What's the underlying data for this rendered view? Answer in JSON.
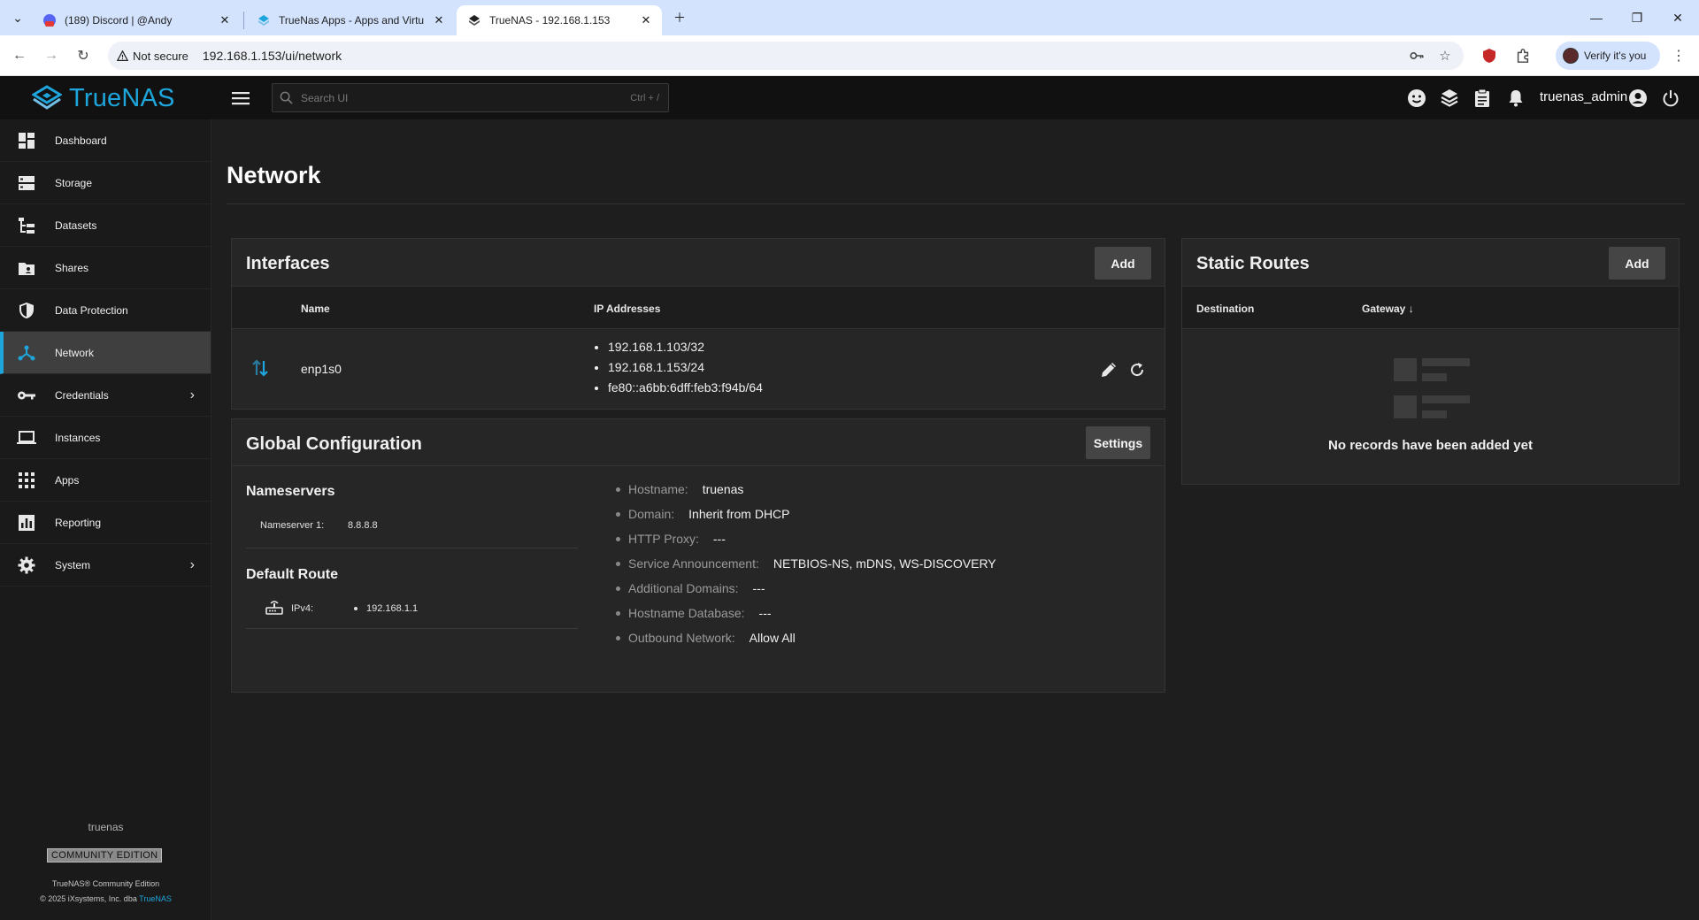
{
  "browser": {
    "tabs": [
      {
        "title": "(189) Discord | @Andy",
        "badge": "189"
      },
      {
        "title": "TrueNas Apps - Apps and Virtu"
      },
      {
        "title": "TrueNAS - 192.168.1.153"
      }
    ],
    "address": {
      "security_label": "Not secure",
      "url": "192.168.1.153/ui/network"
    },
    "verify_label": "Verify it's you"
  },
  "app": {
    "logo_text": "TrueNAS",
    "search_placeholder": "Search UI",
    "search_shortcut": "Ctrl + /",
    "username": "truenas_admin"
  },
  "sidebar": {
    "items": [
      {
        "label": "Dashboard",
        "icon": "dashboard-icon"
      },
      {
        "label": "Storage",
        "icon": "storage-icon"
      },
      {
        "label": "Datasets",
        "icon": "datasets-icon"
      },
      {
        "label": "Shares",
        "icon": "shares-icon"
      },
      {
        "label": "Data Protection",
        "icon": "shield-icon"
      },
      {
        "label": "Network",
        "icon": "network-icon",
        "active": true
      },
      {
        "label": "Credentials",
        "icon": "key-icon",
        "expandable": true
      },
      {
        "label": "Instances",
        "icon": "laptop-icon"
      },
      {
        "label": "Apps",
        "icon": "apps-grid-icon"
      },
      {
        "label": "Reporting",
        "icon": "chart-icon"
      },
      {
        "label": "System",
        "icon": "gear-icon",
        "expandable": true
      }
    ],
    "hostname": "truenas",
    "edition_badge": "COMMUNITY EDITION",
    "footer_line1": "TrueNAS® Community Edition",
    "footer_line2_prefix": "© 2025 iXsystems, Inc. dba ",
    "footer_line2_brand": "TrueNAS"
  },
  "page": {
    "title": "Network"
  },
  "interfaces": {
    "title": "Interfaces",
    "add_label": "Add",
    "columns": {
      "name": "Name",
      "ip": "IP Addresses"
    },
    "rows": [
      {
        "name": "enp1s0",
        "ips": [
          "192.168.1.103/32",
          "192.168.1.153/24",
          "fe80::a6bb:6dff:feb3:f94b/64"
        ]
      }
    ]
  },
  "global_config": {
    "title": "Global Configuration",
    "settings_label": "Settings",
    "nameservers_heading": "Nameservers",
    "nameserver1_label": "Nameserver 1:",
    "nameserver1_value": "8.8.8.8",
    "default_route_heading": "Default Route",
    "ipv4_label": "IPv4:",
    "ipv4_value": "192.168.1.1",
    "fields": [
      {
        "key": "Hostname:",
        "value": "truenas"
      },
      {
        "key": "Domain:",
        "value": "Inherit from DHCP"
      },
      {
        "key": "HTTP Proxy:",
        "value": "---"
      },
      {
        "key": "Service Announcement:",
        "value": "NETBIOS-NS, mDNS, WS-DISCOVERY"
      },
      {
        "key": "Additional Domains:",
        "value": "---"
      },
      {
        "key": "Hostname Database:",
        "value": "---"
      },
      {
        "key": "Outbound Network:",
        "value": "Allow All"
      }
    ]
  },
  "static_routes": {
    "title": "Static Routes",
    "add_label": "Add",
    "columns": {
      "destination": "Destination",
      "gateway": "Gateway"
    },
    "empty_message": "No records have been added yet"
  },
  "colors": {
    "accent": "#1ea5dc",
    "background": "#1e1e1e",
    "card": "#262626"
  }
}
